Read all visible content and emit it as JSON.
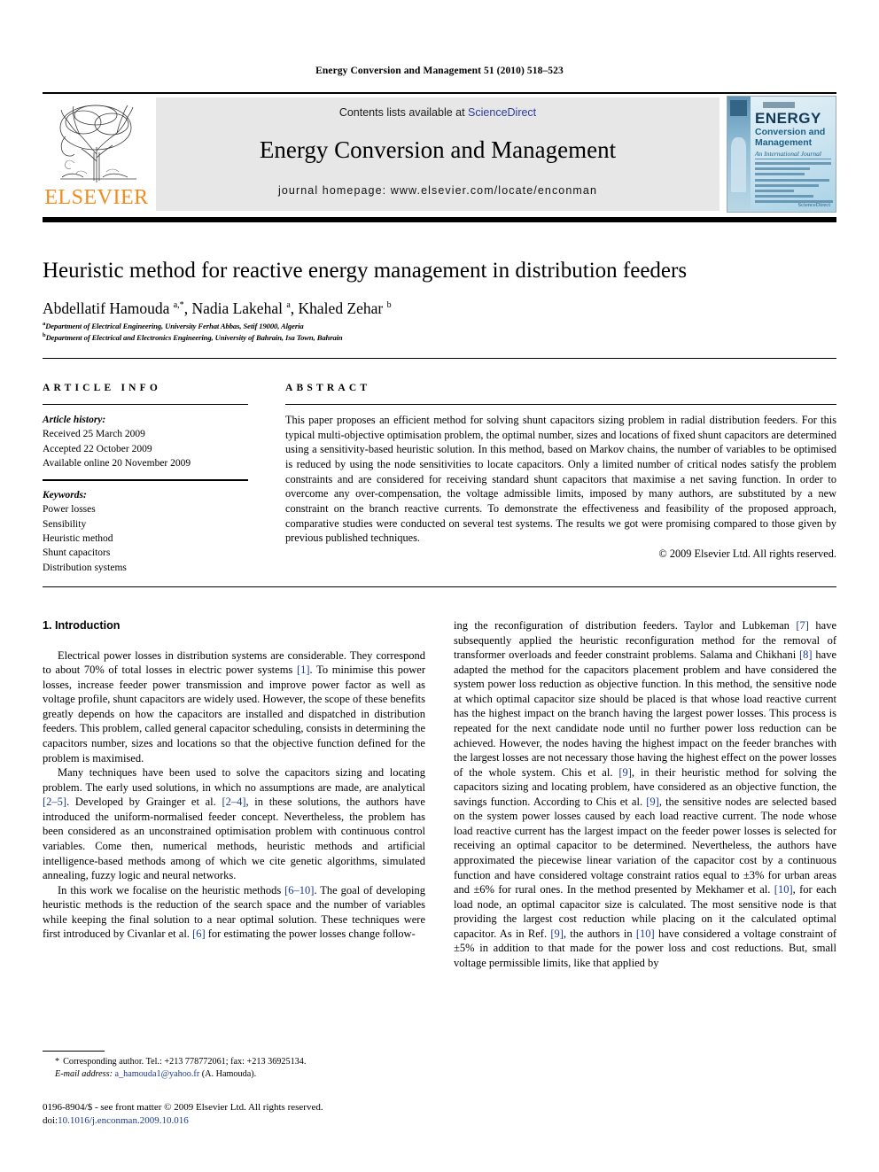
{
  "running_head": "Energy Conversion and Management 51 (2010) 518–523",
  "header": {
    "contents_prefix": "Contents lists available at ",
    "sciencedirect": "ScienceDirect",
    "journal_title": "Energy Conversion and Management",
    "homepage": "journal homepage: www.elsevier.com/locate/enconman",
    "publisher": "ELSEVIER",
    "accent_orange": "#F08C1E",
    "link_blue": "#2b3c9b",
    "panel_grey": "#e7e7e7"
  },
  "cover": {
    "title": "ENERGY",
    "sub1": "Conversion and",
    "sub2": "Management",
    "sub3": "An International Journal",
    "foot": "ScienceDirect"
  },
  "article": {
    "title": "Heuristic method for reactive energy management in distribution feeders",
    "authors_html": "Abdellatif Hamouda <sup>a,*</sup>, Nadia Lakehal <sup>a</sup>, Khaled Zehar <sup>b</sup>",
    "affiliation_a": "Department of Electrical Engineering, University Ferhat Abbas, Setif 19000, Algeria",
    "affiliation_b": "Department of Electrical and Electronics Engineering, University of Bahrain, Isa Town, Bahrain"
  },
  "article_info": {
    "heading": "ARTICLE INFO",
    "history_label": "Article history:",
    "history": [
      "Received 25 March 2009",
      "Accepted 22 October 2009",
      "Available online 20 November 2009"
    ],
    "keywords_label": "Keywords:",
    "keywords": [
      "Power losses",
      "Sensibility",
      "Heuristic method",
      "Shunt capacitors",
      "Distribution systems"
    ]
  },
  "abstract": {
    "heading": "ABSTRACT",
    "text": "This paper proposes an efficient method for solving shunt capacitors sizing problem in radial distribution feeders. For this typical multi-objective optimisation problem, the optimal number, sizes and locations of fixed shunt capacitors are determined using a sensitivity-based heuristic solution. In this method, based on Markov chains, the number of variables to be optimised is reduced by using the node sensitivities to locate capacitors. Only a limited number of critical nodes satisfy the problem constraints and are considered for receiving standard shunt capacitors that maximise a net saving function. In order to overcome any over-compensation, the voltage admissible limits, imposed by many authors, are substituted by a new constraint on the branch reactive currents. To demonstrate the effectiveness and feasibility of the proposed approach, comparative studies were conducted on several test systems. The results we got were promising compared to those given by previous published techniques.",
    "copyright": "© 2009 Elsevier Ltd. All rights reserved."
  },
  "body": {
    "section_heading": "1. Introduction",
    "left_paragraphs": [
      "Electrical power losses in distribution systems are considerable. They correspond to about 70% of total losses in electric power systems [1]. To minimise this power losses, increase feeder power transmission and improve power factor as well as voltage profile, shunt capacitors are widely used. However, the scope of these benefits greatly depends on how the capacitors are installed and dispatched in distribution feeders. This problem, called general capacitor scheduling, consists in determining the capacitors number, sizes and locations so that the objective function defined for the problem is maximised.",
      "Many techniques have been used to solve the capacitors sizing and locating problem. The early used solutions, in which no assumptions are made, are analytical [2–5]. Developed by Grainger et al. [2–4], in these solutions, the authors have introduced the uniform-normalised feeder concept. Nevertheless, the problem has been considered as an unconstrained optimisation problem with continuous control variables. Come then, numerical methods, heuristic methods and artificial intelligence-based methods among of which we cite genetic algorithms, simulated annealing, fuzzy logic and neural networks.",
      "In this work we focalise on the heuristic methods [6–10]. The goal of developing heuristic methods is the reduction of the search space and the number of variables while keeping the final solution to a near optimal solution. These techniques were first introduced by Civanlar et al. [6] for estimating the power losses change follow-"
    ],
    "right_paragraphs": [
      "ing the reconfiguration of distribution feeders. Taylor and Lubkeman [7] have subsequently applied the heuristic reconfiguration method for the removal of transformer overloads and feeder constraint problems. Salama and Chikhani [8] have adapted the method for the capacitors placement problem and have considered the system power loss reduction as objective function. In this method, the sensitive node at which optimal capacitor size should be placed is that whose load reactive current has the highest impact on the branch having the largest power losses. This process is repeated for the next candidate node until no further power loss reduction can be achieved. However, the nodes having the highest impact on the feeder branches with the largest losses are not necessary those having the highest effect on the power losses of the whole system. Chis et al. [9], in their heuristic method for solving the capacitors sizing and locating problem, have considered as an objective function, the savings function. According to Chis et al. [9], the sensitive nodes are selected based on the system power losses caused by each load reactive current. The node whose load reactive current has the largest impact on the feeder power losses is selected for receiving an optimal capacitor to be determined. Nevertheless, the authors have approximated the piecewise linear variation of the capacitor cost by a continuous function and have considered voltage constraint ratios equal to ±3% for urban areas and ±6% for rural ones. In the method presented by Mekhamer et al. [10], for each load node, an optimal capacitor size is calculated. The most sensitive node is that providing the largest cost reduction while placing on it the calculated optimal capacitor. As in Ref. [9], the authors in [10] have considered a voltage constraint of ±5% in addition to that made for the power loss and cost reductions. But, small voltage permissible limits, like that applied by"
    ]
  },
  "footnote": {
    "corresponding": "Corresponding author. Tel.: +213 778772061; fax: +213 36925134.",
    "email_label": "E-mail address:",
    "email": "a_hamouda1@yahoo.fr",
    "email_suffix": "(A. Hamouda)."
  },
  "imprint": {
    "issn_line": "0196-8904/$ - see front matter © 2009 Elsevier Ltd. All rights reserved.",
    "doi_label": "doi:",
    "doi": "10.1016/j.enconman.2009.10.016"
  }
}
